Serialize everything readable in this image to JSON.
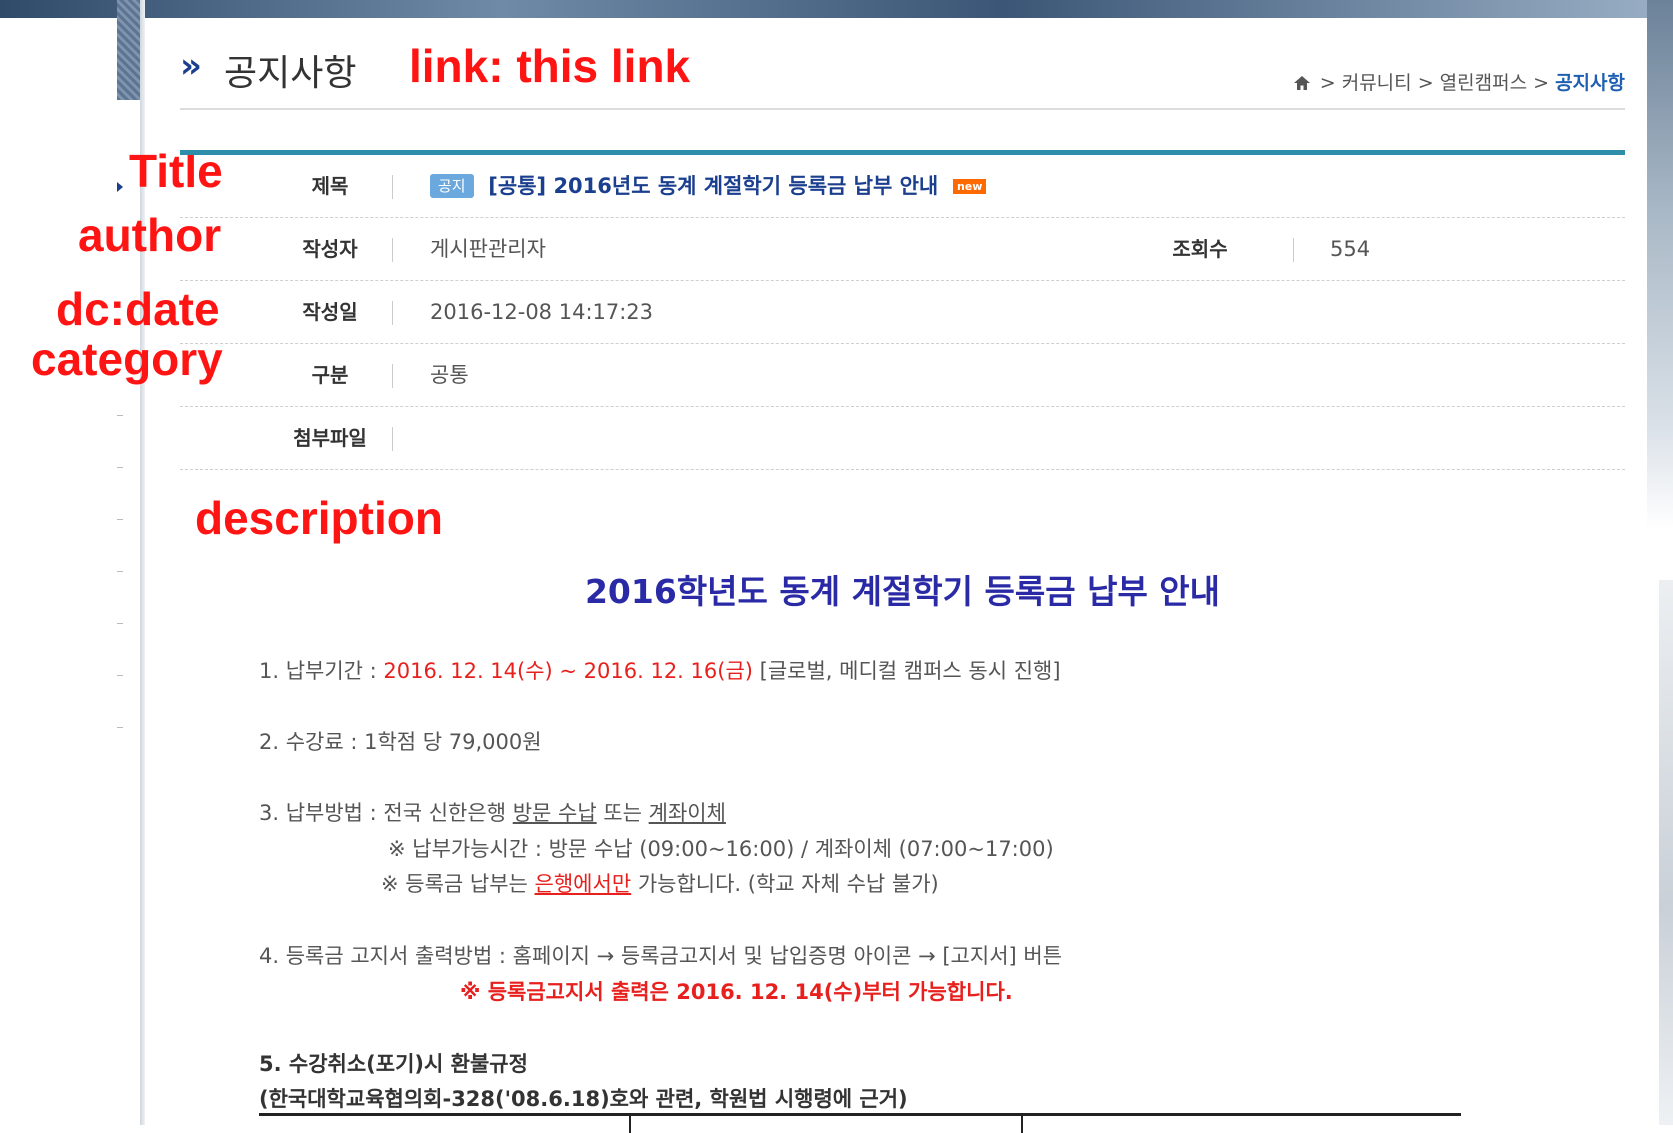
{
  "annotations": {
    "link": "link: this link",
    "title": "Title",
    "author": "author",
    "date": "dc:date",
    "category": "category",
    "description": "description"
  },
  "header": {
    "title": "공지사항",
    "chevron": "»",
    "breadcrumb": [
      "커뮤니티",
      "열린캠퍼스"
    ],
    "breadcrumb_current": "공지사항",
    "separator": ">"
  },
  "post": {
    "subject_label": "제목",
    "badge": "공지",
    "subject": "[공통] 2016년도 동계 계절학기 등록금 납부 안내",
    "new_badge": "new",
    "author_label": "작성자",
    "author": "게시판관리자",
    "views_label": "조회수",
    "views": "554",
    "date_label": "작성일",
    "date": "2016-12-08 14:17:23",
    "category_label": "구분",
    "category": "공통",
    "attachment_label": "첨부파일",
    "attachment": ""
  },
  "body": {
    "heading": "2016학년도 동계 계절학기 등록금 납부 안내",
    "p1_prefix": "1. 납부기간 : ",
    "p1_dates": "2016. 12. 14(수) ~ 2016. 12. 16(금)",
    "p1_suffix": " [글로벌, 메디컬 캠퍼스 동시 진행]",
    "p2": "2. 수강료 : 1학점 당 79,000원",
    "p3_prefix": "3. 납부방법 : 전국 신한은행 ",
    "p3_visit": "방문 수납",
    "p3_or": " 또는 ",
    "p3_transfer": "계좌이체",
    "p3_note1": "※ 납부가능시간 :   방문 수납 (09:00~16:00) / 계좌이체 (07:00~17:00)",
    "p3_note2_prefix": "※ 등록금 납부는 ",
    "p3_note2_red": "은행에서만",
    "p3_note2_suffix": " 가능합니다. (학교 자체 수납 불가)",
    "p4": "4. 등록금 고지서 출력방법 : 홈페이지  → 등록금고지서 및 납입증명 아이콘 → [고지서] 버튼",
    "p4_note": "※ 등록금고지서 출력은 2016. 12. 14(수)부터 가능합니다.",
    "p5": "5. 수강취소(포기)시 환불규정",
    "p5_sub": "(한국대학교육협의회-328('08.6.18)호와 관련, 학원법 시행령에 근거)"
  },
  "colors": {
    "annotation": "#ff1414",
    "accent": "#2e8eaa",
    "title_blue": "#1b3f8f",
    "heading_blue": "#2a2aa6",
    "highlight_red": "#e8201d"
  }
}
